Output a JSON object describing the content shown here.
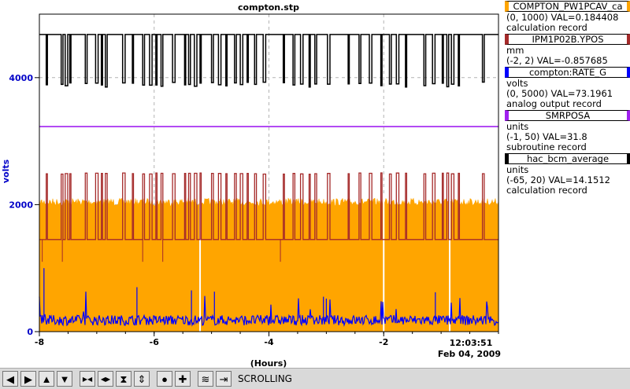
{
  "chart_data": {
    "type": "line",
    "title": "compton.stp",
    "xlabel": "(Hours)",
    "ylabel": "volts",
    "xlim": [
      -8,
      0
    ],
    "ylim": [
      0,
      5000
    ],
    "x_ticks": [
      -8,
      -6,
      -4,
      -2
    ],
    "x_tick_labels": [
      "-8",
      "-6",
      "-4",
      "-2"
    ],
    "y_ticks": [
      0,
      2000,
      4000
    ],
    "y_tick_labels": [
      "0",
      "2000",
      "4000"
    ],
    "end_time": "12:03:51",
    "end_date": "Feb 04, 2009",
    "grid": true,
    "series": [
      {
        "name": "COMPTON_PW1PCAV_ca",
        "color": "#ffa500",
        "style": "dense-noise",
        "baseline": 0,
        "top": 2100,
        "range": [
          0,
          1000
        ],
        "value": "0.184408",
        "record_type": "calculation record"
      },
      {
        "name": "IPM1P02B.YPOS",
        "color": "#a52a2a",
        "style": "dropouts",
        "level": 1450,
        "spike_to": 2500,
        "units": "mm",
        "range": [
          -2,
          2
        ],
        "value": "-0.857685",
        "record_type": ""
      },
      {
        "name": "compton:RATE_G",
        "color": "#0000ff",
        "style": "noise",
        "level": 180,
        "units": "volts",
        "range": [
          0,
          5000
        ],
        "value": "73.1961",
        "record_type": "analog output record"
      },
      {
        "name": "SMRPOSA",
        "color": "#a020f0",
        "style": "flat",
        "level": 3230,
        "units": "units",
        "range": [
          -1,
          50
        ],
        "value": "31.8",
        "record_type": "subroutine record"
      },
      {
        "name": "hac_bcm_average",
        "color": "#000000",
        "style": "dropouts",
        "level": 4680,
        "drop_to": 3850,
        "units": "units",
        "range": [
          -65,
          20
        ],
        "value": "14.1512",
        "record_type": "calculation record"
      }
    ]
  },
  "legend": {
    "items": [
      {
        "name": "COMPTON_PW1PCAV_ca",
        "color": "#ffa500",
        "units": "",
        "range_val": "(0, 1000) VAL=0.184408",
        "record": "calculation record"
      },
      {
        "name": "IPM1P02B.YPOS",
        "color": "#a52a2a",
        "units": "mm",
        "range_val": "(-2, 2) VAL=-0.857685",
        "record": ""
      },
      {
        "name": "compton:RATE_G",
        "color": "#0000ff",
        "units": "volts",
        "range_val": "(0, 5000) VAL=73.1961",
        "record": "analog output record"
      },
      {
        "name": "SMRPOSA",
        "color": "#a020f0",
        "units": "units",
        "range_val": "(-1, 50) VAL=31.8",
        "record": "subroutine record"
      },
      {
        "name": "hac_bcm_average",
        "color": "#000000",
        "units": "units",
        "range_val": "(-65, 20) VAL=14.1512",
        "record": "calculation record"
      }
    ]
  },
  "toolbar": {
    "buttons": [
      {
        "name": "left-arrow-button",
        "glyph": "◀"
      },
      {
        "name": "right-arrow-button",
        "glyph": "▶"
      },
      {
        "name": "up-arrow-button",
        "glyph": "▲"
      },
      {
        "name": "down-arrow-button",
        "glyph": "▼"
      },
      {
        "name": "compress-horizontal-button",
        "glyph": "▶◀"
      },
      {
        "name": "expand-horizontal-button",
        "glyph": "◀▶"
      },
      {
        "name": "compress-vertical-button",
        "glyph": "⧗"
      },
      {
        "name": "expand-vertical-button",
        "glyph": "⇕"
      },
      {
        "name": "zoom-reset-button",
        "glyph": "●"
      },
      {
        "name": "zoom-in-button",
        "glyph": "✚"
      },
      {
        "name": "autoscale-button",
        "glyph": "≋"
      },
      {
        "name": "scroll-to-end-button",
        "glyph": "⇥"
      }
    ],
    "status": "SCROLLING"
  }
}
